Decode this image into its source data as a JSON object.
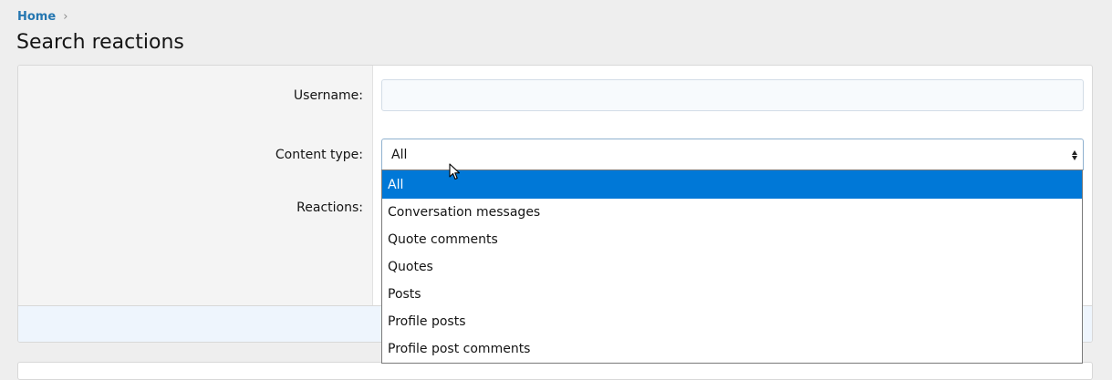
{
  "breadcrumb": {
    "home_label": "Home",
    "separator": "›"
  },
  "page": {
    "title": "Search reactions"
  },
  "form": {
    "username": {
      "label": "Username:",
      "value": "",
      "placeholder": ""
    },
    "content_type": {
      "label": "Content type:",
      "selected": "All",
      "options": [
        "All",
        "Conversation messages",
        "Quote comments",
        "Quotes",
        "Posts",
        "Profile posts",
        "Profile post comments"
      ],
      "selected_index": 0
    },
    "reactions": {
      "label": "Reactions:"
    }
  },
  "colors": {
    "link": "#2577b1",
    "selected_option": "#0078d7",
    "page_bg": "#eeeeee",
    "label_col_bg": "#f4f4f4",
    "footer_bg": "#eef5fd"
  },
  "icons": {
    "breadcrumb_separator": "chevron-right-icon",
    "select_arrows": "sort-arrows-icon",
    "pointer": "mouse-cursor-icon"
  }
}
